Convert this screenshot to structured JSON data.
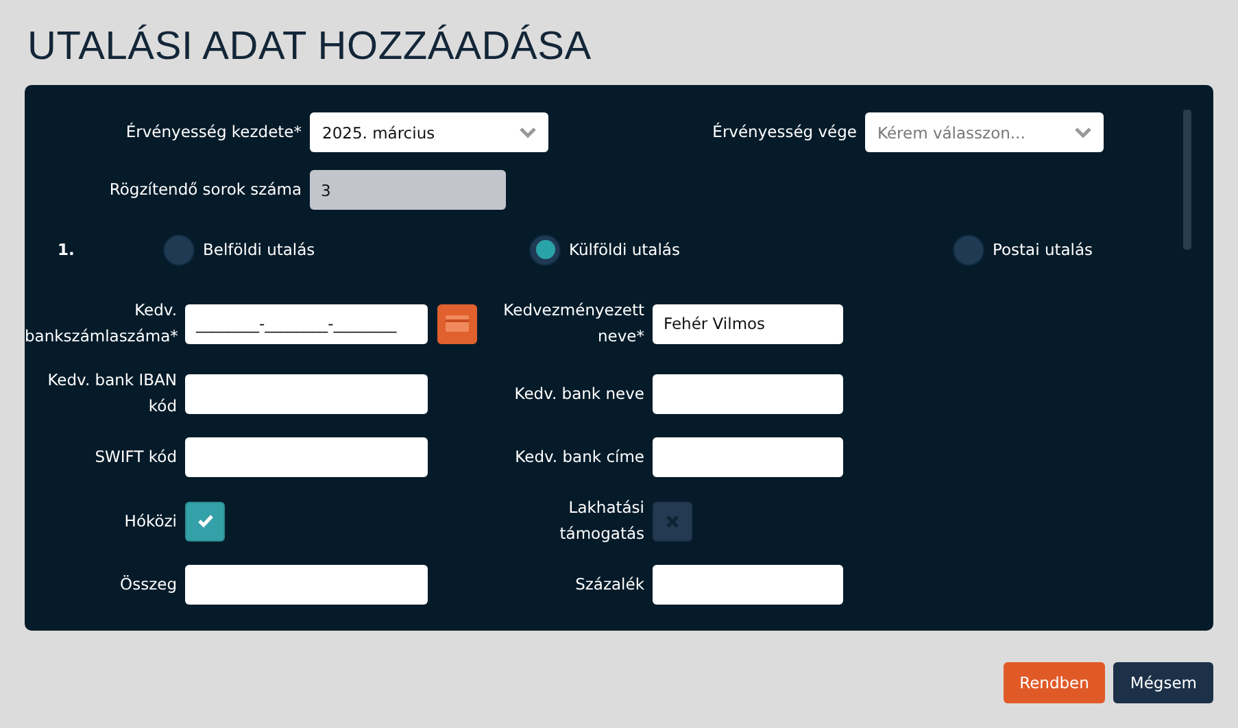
{
  "title": "UTALÁSI ADAT HOZZÁADÁSA",
  "validity": [
    {
      "label": "Érvényesség kezdete*",
      "value": "2025. március"
    },
    {
      "label": "Érvényesség vége",
      "placeholder": "Kérem válasszon..."
    }
  ],
  "row_count": {
    "label": "Rögzítendő sorok száma",
    "value": "3",
    "disabled": true
  },
  "row_number": "1.",
  "transfer_types": [
    {
      "label": "Belföldi utalás",
      "selected": false
    },
    {
      "label": "Külföldi utalás",
      "selected": true
    },
    {
      "label": "Postai utalás",
      "selected": false
    }
  ],
  "field_rows": [
    {
      "left": {
        "kind": "account",
        "label": "Kedv. bankszámlaszáma*",
        "value": "________-________-________"
      },
      "right": {
        "kind": "text",
        "label": "Kedvezményezett neve*",
        "value": "Fehér Vilmos"
      }
    },
    {
      "left": {
        "kind": "text",
        "label": "Kedv. bank IBAN kód"
      },
      "right": {
        "kind": "text",
        "label": "Kedv. bank neve"
      }
    },
    {
      "left": {
        "kind": "text",
        "label": "SWIFT kód"
      },
      "right": {
        "kind": "text",
        "label": "Kedv. bank címe"
      }
    },
    {
      "left": {
        "kind": "checkbox",
        "label": "Hóközi",
        "checked": true
      },
      "right": {
        "kind": "checkbox",
        "label": "Lakhatási támogatás",
        "checked": false
      }
    },
    {
      "left": {
        "kind": "text",
        "label": "Összeg"
      },
      "right": {
        "kind": "text",
        "label": "Százalék"
      }
    }
  ],
  "buttons": [
    {
      "label": "Rendben",
      "kind": "primary"
    },
    {
      "label": "Mégsem",
      "kind": "secondary"
    }
  ]
}
